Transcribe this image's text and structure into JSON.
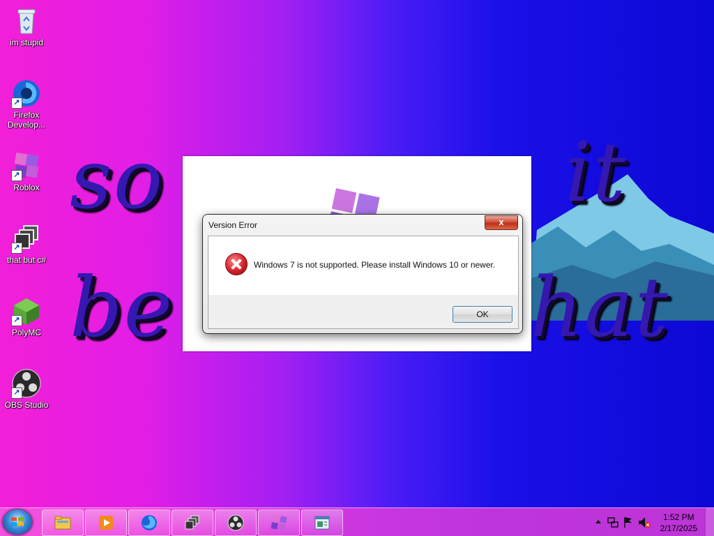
{
  "desktop": {
    "wallpaper_text": {
      "line1_left": "so",
      "line1_right": "it",
      "line2_left": "be",
      "line2_right": "hat"
    },
    "icons": [
      {
        "label": "im stupid",
        "icon": "recycle-bin-icon"
      },
      {
        "label": "Firefox Develop...",
        "icon": "firefox-developer-icon"
      },
      {
        "label": "Roblox",
        "icon": "roblox-icon"
      },
      {
        "label": "that but c#",
        "icon": "windows-stack-icon"
      },
      {
        "label": "PolyMC",
        "icon": "polymc-icon"
      },
      {
        "label": "OBS Studio",
        "icon": "obs-studio-icon"
      }
    ]
  },
  "dialog": {
    "title": "Version Error",
    "close_label": "x",
    "message": "Windows 7 is not supported. Please install Windows 10 or newer.",
    "ok_label": "OK"
  },
  "taskbar": {
    "buttons": [
      {
        "icon": "file-explorer-icon"
      },
      {
        "icon": "media-player-icon"
      },
      {
        "icon": "firefox-icon"
      },
      {
        "icon": "windows-stack-icon"
      },
      {
        "icon": "obs-studio-icon"
      },
      {
        "icon": "roblox-icon"
      },
      {
        "icon": "app-window-icon"
      }
    ],
    "clock": {
      "time": "1:52 PM",
      "date": "2/17/2025"
    }
  },
  "colors": {
    "accent": "#f21fd8",
    "dialog_close": "#c02d16",
    "error": "#d2202a"
  }
}
